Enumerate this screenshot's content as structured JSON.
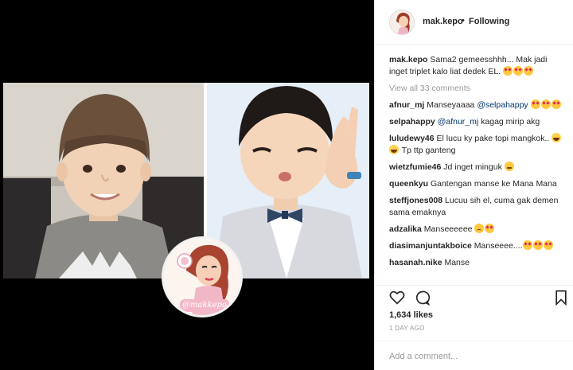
{
  "post": {
    "username": "mak.kepo",
    "separator": "•",
    "follow_status": "Following",
    "watermark_text": "@makkepo"
  },
  "caption": {
    "user": "mak.kepo",
    "text": "Sama2 gemeesshhh... Mak jadi inget triplet kalo liat dedek EL."
  },
  "view_all": "View all 33 comments",
  "comments": [
    {
      "user": "afnur_mj",
      "text": "Manseyaaaa",
      "mention": "@selpahappy"
    },
    {
      "user": "selpahappy",
      "mention": "@afnur_mj",
      "text": "kagag mirip akg"
    },
    {
      "user": "luludewy46",
      "text": "El lucu ky pake topi mangkok..",
      "text2": "Tp ttp ganteng"
    },
    {
      "user": "wietzfumie46",
      "text": "Jd inget minguk"
    },
    {
      "user": "queenkyu",
      "text": "Gantengan manse ke Mana Mana"
    },
    {
      "user": "steffjones008",
      "text": "Lucuu sih el, cuma gak demen sama emaknya"
    },
    {
      "user": "adzalika",
      "text": "Manseeeeee"
    },
    {
      "user": "diasimanjuntakboice",
      "text": "Manseeee...."
    },
    {
      "user": "hasanah.nike",
      "text": "Manse"
    }
  ],
  "likes": "1,634 likes",
  "time": "1 DAY AGO",
  "add_comment_placeholder": "Add a comment...",
  "colors": {
    "link": "#003569",
    "muted": "#999999",
    "border": "#efefef",
    "accent_pink": "#f3b8c8"
  }
}
